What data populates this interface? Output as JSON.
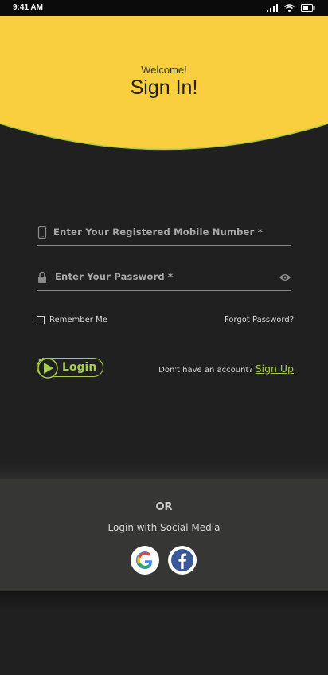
{
  "status_bar": {
    "time": "9:41 AM",
    "icons": [
      "signal-icon",
      "wifi-icon",
      "battery-icon"
    ]
  },
  "header": {
    "greeting": "Welcome!",
    "title": "Sign In!"
  },
  "form": {
    "mobile": {
      "placeholder": "Enter Your Registered Mobile Number *",
      "icon": "phone-icon"
    },
    "password": {
      "placeholder": "Enter Your Password *",
      "icon": "lock-icon",
      "toggle_icon": "eye-icon"
    },
    "remember_label": "Remember Me",
    "remember_checked": false,
    "forgot_label": "Forgot Password?"
  },
  "actions": {
    "login_label": "Login",
    "signup_prompt": "Don't have an account?",
    "signup_link": "Sign Up"
  },
  "social": {
    "or_label": "OR",
    "label": "Login with Social Media",
    "providers": [
      "google-icon",
      "facebook-icon"
    ]
  },
  "colors": {
    "background": "#1f201f",
    "header_yellow": "#f9cf3f",
    "accent_green": "#a6cd4a",
    "panel": "#363735"
  }
}
